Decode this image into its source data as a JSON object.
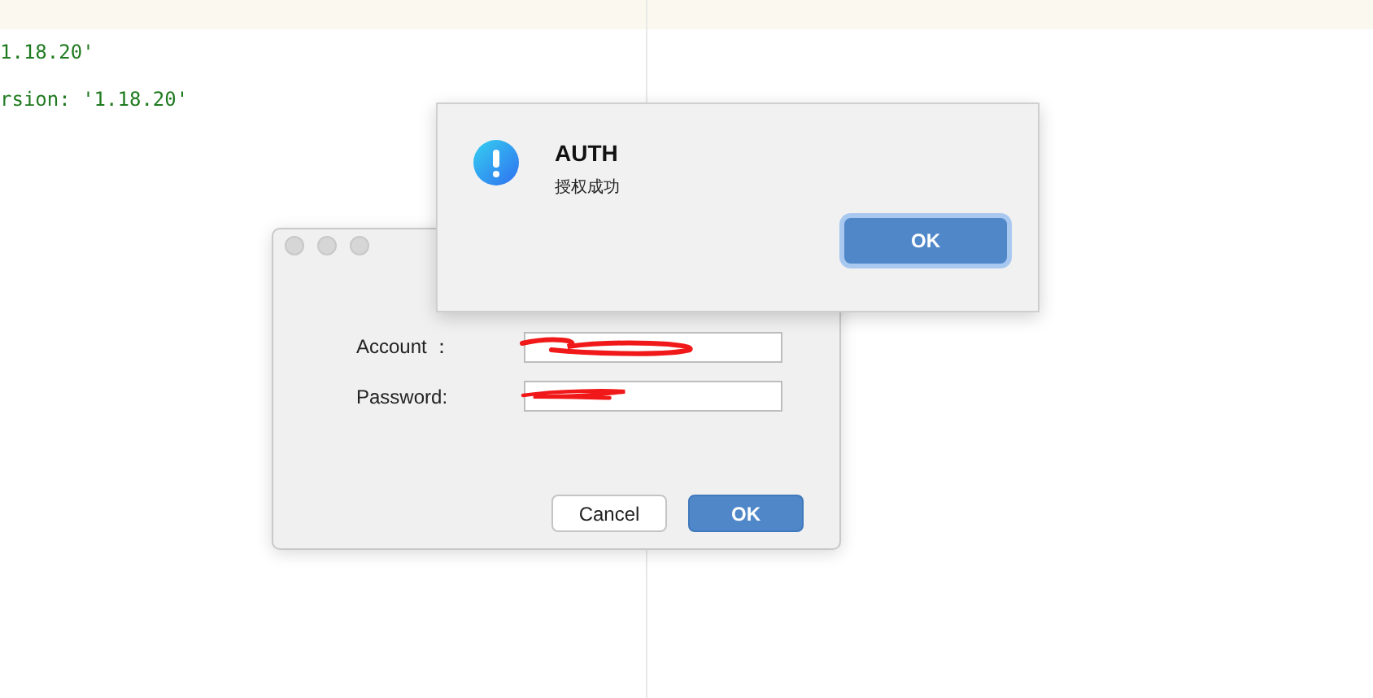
{
  "editor": {
    "lines": [
      {
        "text": "1.18.20'"
      },
      {
        "text": "rsion: '1.18.20'"
      }
    ]
  },
  "login_dialog": {
    "fields": [
      {
        "label": "Account ："
      },
      {
        "label": "Password:"
      }
    ],
    "buttons": [
      {
        "label": "Cancel",
        "default": false
      },
      {
        "label": "OK",
        "default": true
      }
    ]
  },
  "alert": {
    "title": "AUTH",
    "message": "授权成功",
    "buttons": [
      {
        "label": "OK",
        "default": true
      }
    ]
  }
}
